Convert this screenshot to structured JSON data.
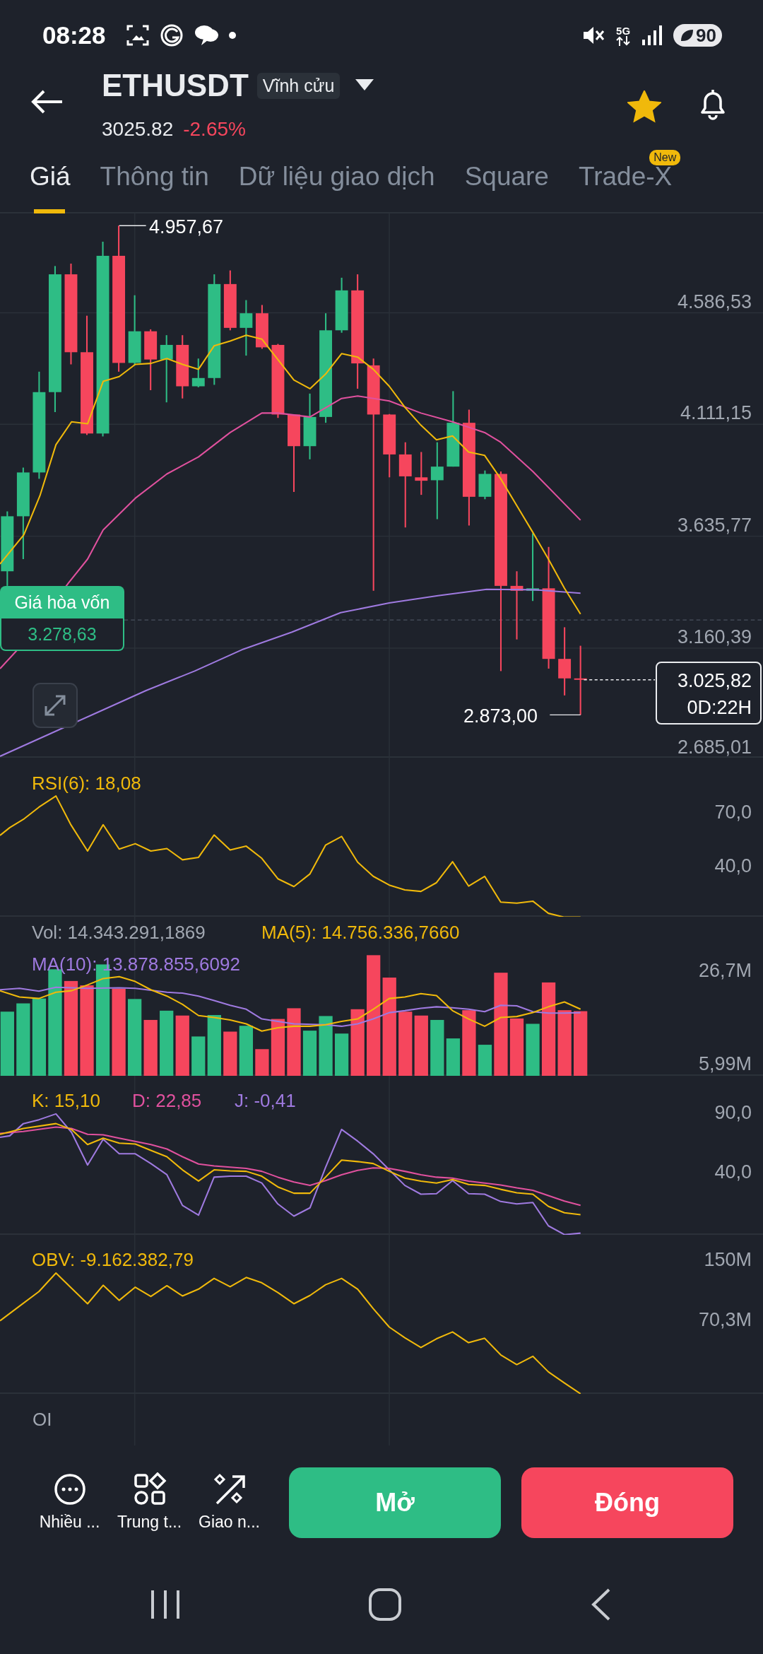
{
  "status_bar": {
    "time": "08:28",
    "network": "5G",
    "battery": "90"
  },
  "header": {
    "symbol": "ETHUSDT",
    "contract_type": "Vĩnh cửu",
    "price": "3025.82",
    "change": "-2.65%",
    "favorite": true
  },
  "tabs": [
    {
      "label": "Giá",
      "selected": true
    },
    {
      "label": "Thông tin",
      "selected": false
    },
    {
      "label": "Dữ liệu giao dịch",
      "selected": false
    },
    {
      "label": "Square",
      "selected": false
    },
    {
      "label": "Trade-X",
      "selected": false,
      "badge": "New"
    }
  ],
  "price_chart": {
    "high_label": "4.957,67",
    "low_label": "2.873,00",
    "axis_labels": [
      "4.586,53",
      "4.111,15",
      "3.635,77",
      "3.160,39",
      "2.685,01"
    ],
    "breakeven": {
      "label": "Giá hòa vốn",
      "value": "3.278,63"
    },
    "last_price": {
      "value": "3.025,82",
      "countdown": "0D:22H"
    }
  },
  "rsi": {
    "legends": [
      {
        "text": "RSI(6): 18,08",
        "color": "#f0b90b"
      }
    ],
    "axis_labels": [
      "70,0",
      "40,0"
    ]
  },
  "volume": {
    "legends": [
      {
        "text": "Vol: 14.343.291,1869",
        "color": "#a1a7b1"
      },
      {
        "text": "MA(5): 14.756.336,7660",
        "color": "#f0b90b"
      },
      {
        "text": "MA(10): 13.878.855,6092",
        "color": "#9f7ae0"
      }
    ],
    "axis_labels": [
      "26,7M",
      "5,99M"
    ]
  },
  "kdj": {
    "legends": [
      {
        "text": "K: 15,10",
        "color": "#f0b90b"
      },
      {
        "text": "D: 22,85",
        "color": "#e0519e"
      },
      {
        "text": "J: -0,41",
        "color": "#9f7ae0"
      }
    ],
    "axis_labels": [
      "90,0",
      "40,0"
    ]
  },
  "obv": {
    "legends": [
      {
        "text": "OBV: -9.162.382,79",
        "color": "#f0b90b"
      }
    ],
    "axis_labels": [
      "150M",
      "70,3M"
    ]
  },
  "oi": {
    "legends": [
      {
        "text": "OI",
        "color": "#a1a7b1"
      }
    ]
  },
  "toolbar": {
    "items": [
      {
        "label": "Nhiều ...",
        "kind": "more"
      },
      {
        "label": "Trung t...",
        "kind": "apps"
      },
      {
        "label": "Giao n...",
        "kind": "trade"
      }
    ],
    "buttons": [
      {
        "label": "Mở",
        "kind": "open"
      },
      {
        "label": "Đóng",
        "kind": "close"
      }
    ]
  }
}
